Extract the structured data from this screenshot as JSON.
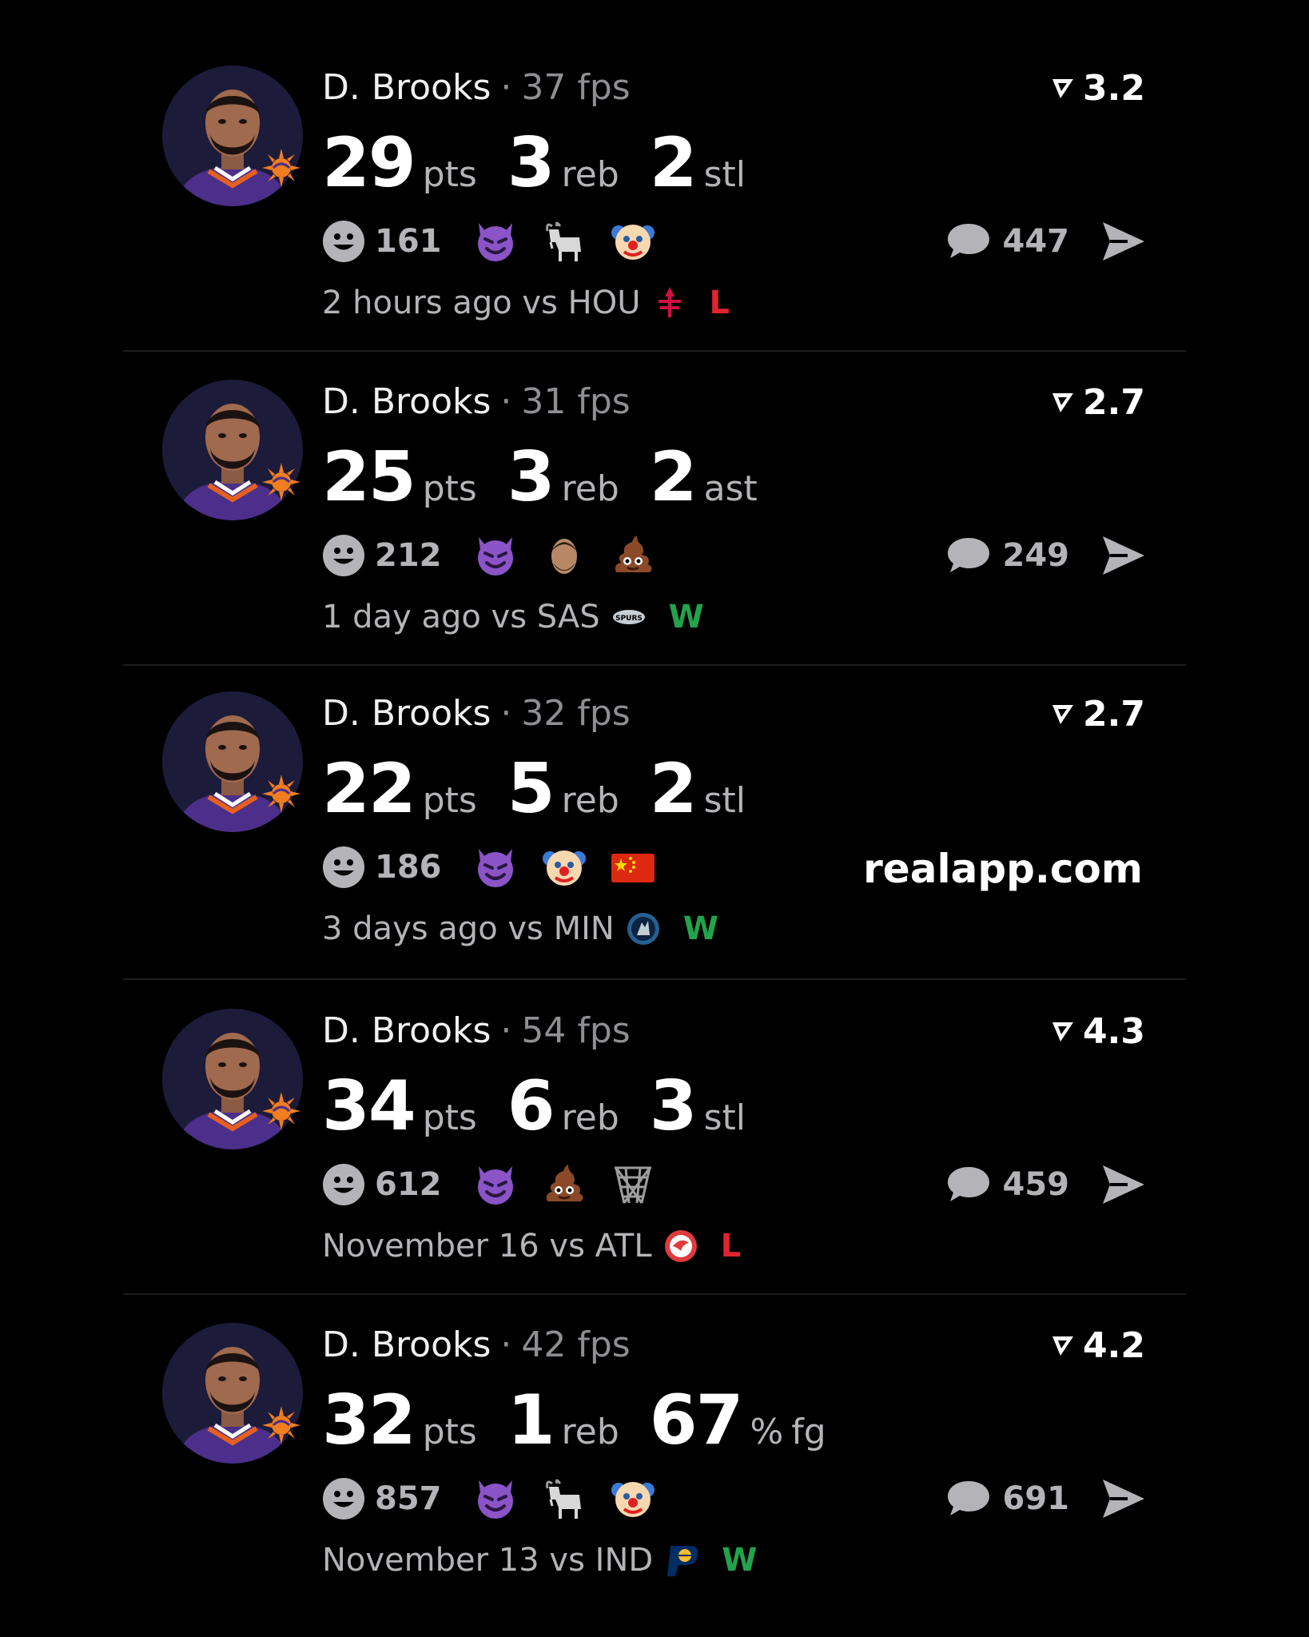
{
  "cards": [
    {
      "player": "D. Brooks",
      "separator": "·",
      "fps": "37 fps",
      "rating": "3.2",
      "stats": [
        {
          "value": "29",
          "unit": "pts"
        },
        {
          "value": "3",
          "unit": "reb"
        },
        {
          "value": "2",
          "unit": "stl"
        }
      ],
      "reaction_count": "161",
      "emojis": [
        "smiling-devil",
        "goat",
        "clown"
      ],
      "comment_count": "447",
      "time": "2 hours ago",
      "vs": "vs",
      "opponent": "HOU",
      "opponent_logo": "rockets-logo",
      "result": "L",
      "result_color": "#e0242f"
    },
    {
      "player": "D. Brooks",
      "separator": "·",
      "fps": "31 fps",
      "rating": "2.7",
      "stats": [
        {
          "value": "25",
          "unit": "pts"
        },
        {
          "value": "3",
          "unit": "reb"
        },
        {
          "value": "2",
          "unit": "ast"
        }
      ],
      "reaction_count": "212",
      "emojis": [
        "smiling-devil",
        "player-face",
        "poop"
      ],
      "comment_count": "249",
      "time": "1 day ago",
      "vs": "vs",
      "opponent": "SAS",
      "opponent_logo": "spurs-logo",
      "result": "W",
      "result_color": "#22a34c"
    },
    {
      "player": "D. Brooks",
      "separator": "·",
      "fps": "32 fps",
      "rating": "2.7",
      "stats": [
        {
          "value": "22",
          "unit": "pts"
        },
        {
          "value": "5",
          "unit": "reb"
        },
        {
          "value": "2",
          "unit": "stl"
        }
      ],
      "reaction_count": "186",
      "emojis": [
        "smiling-devil",
        "clown",
        "china-flag"
      ],
      "watermark": "realapp.com",
      "time": "3 days ago",
      "vs": "vs",
      "opponent": "MIN",
      "opponent_logo": "timberwolves-logo",
      "result": "W",
      "result_color": "#22a34c"
    },
    {
      "player": "D. Brooks",
      "separator": "·",
      "fps": "54 fps",
      "rating": "4.3",
      "stats": [
        {
          "value": "34",
          "unit": "pts"
        },
        {
          "value": "6",
          "unit": "reb"
        },
        {
          "value": "3",
          "unit": "stl"
        }
      ],
      "reaction_count": "612",
      "emojis": [
        "smiling-devil",
        "poop",
        "basketball-net"
      ],
      "comment_count": "459",
      "time": "November 16",
      "vs": "vs",
      "opponent": "ATL",
      "opponent_logo": "hawks-logo",
      "result": "L",
      "result_color": "#e0242f"
    },
    {
      "player": "D. Brooks",
      "separator": "·",
      "fps": "42 fps",
      "rating": "4.2",
      "stats": [
        {
          "value": "32",
          "unit": "pts"
        },
        {
          "value": "1",
          "unit": "reb"
        },
        {
          "value": "67",
          "unit": "%",
          "unit2": "fg"
        }
      ],
      "reaction_count": "857",
      "emojis": [
        "smiling-devil",
        "goat",
        "clown"
      ],
      "comment_count": "691",
      "time": "November 13",
      "vs": "vs",
      "opponent": "IND",
      "opponent_logo": "pacers-logo",
      "result": "W",
      "result_color": "#22a34c"
    }
  ]
}
